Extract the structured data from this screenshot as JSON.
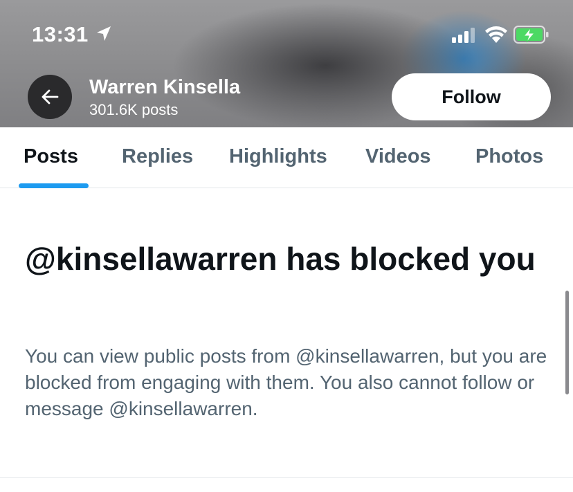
{
  "status_bar": {
    "time": "13:31",
    "icons": [
      "location-arrow-icon",
      "cellular-signal-icon",
      "wifi-icon",
      "battery-charging-icon"
    ],
    "battery_color": "#4cd964"
  },
  "profile_header": {
    "name": "Warren Kinsella",
    "post_count": "301.6K posts",
    "follow_label": "Follow",
    "back_icon": "arrow-left-icon"
  },
  "tabs": [
    {
      "label": "Posts",
      "active": true
    },
    {
      "label": "Replies",
      "active": false
    },
    {
      "label": "Highlights",
      "active": false
    },
    {
      "label": "Videos",
      "active": false
    },
    {
      "label": "Photos",
      "active": false
    }
  ],
  "blocked_notice": {
    "title": "@kinsellawarren has blocked you",
    "body": "You can view public posts from @kinsellawarren, but you are blocked from engaging with them. You also cannot follow or message @kinsellawarren."
  },
  "colors": {
    "accent": "#1d9bf0",
    "primary_text": "#0f1419",
    "secondary_text": "#536471"
  }
}
